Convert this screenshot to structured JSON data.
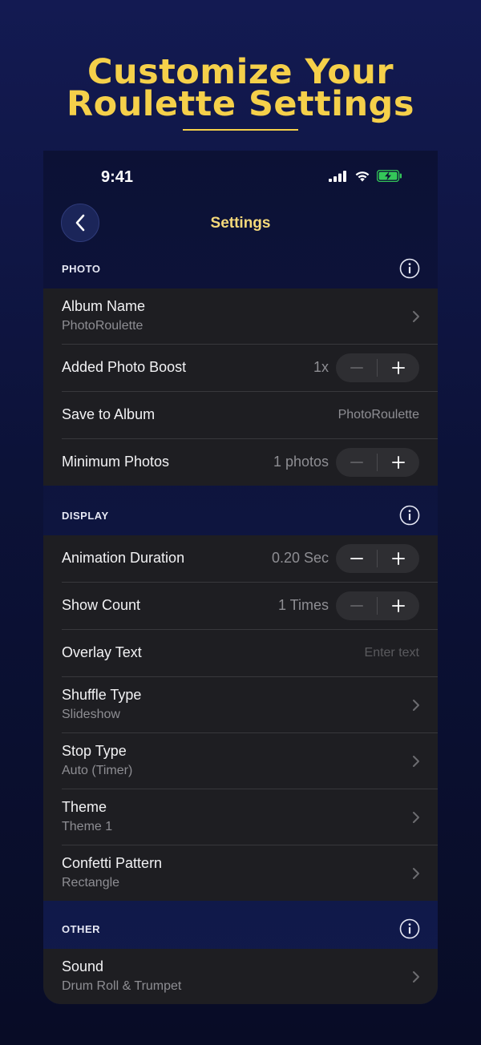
{
  "headline": {
    "line1": "Customize Your",
    "line2": "Roulette Settings"
  },
  "status_bar": {
    "time": "9:41"
  },
  "nav": {
    "title": "Settings"
  },
  "sections": {
    "photo": {
      "label": "PHOTO",
      "album_name": {
        "title": "Album Name",
        "subtitle": "PhotoRoulette"
      },
      "photo_boost": {
        "title": "Added Photo Boost",
        "value": "1x"
      },
      "save_to_album": {
        "title": "Save to Album",
        "value": "PhotoRoulette"
      },
      "minimum_photos": {
        "title": "Minimum Photos",
        "value": "1 photos"
      }
    },
    "display": {
      "label": "DISPLAY",
      "animation_duration": {
        "title": "Animation Duration",
        "value": "0.20 Sec"
      },
      "show_count": {
        "title": "Show Count",
        "value": "1 Times"
      },
      "overlay_text": {
        "title": "Overlay Text",
        "placeholder": "Enter text"
      },
      "shuffle_type": {
        "title": "Shuffle Type",
        "subtitle": "Slideshow"
      },
      "stop_type": {
        "title": "Stop Type",
        "subtitle": "Auto (Timer)"
      },
      "theme": {
        "title": "Theme",
        "subtitle": "Theme 1"
      },
      "confetti_pattern": {
        "title": "Confetti Pattern",
        "subtitle": "Rectangle"
      }
    },
    "other": {
      "label": "OTHER",
      "sound": {
        "title": "Sound",
        "subtitle": "Drum Roll & Trumpet"
      }
    }
  },
  "icons": {
    "back": "chevron-left-icon",
    "info": "info-icon",
    "chevron": "chevron-right-icon",
    "minus": "minus-icon",
    "plus": "plus-icon"
  },
  "colors": {
    "accent_gold": "#f5d04a",
    "background_navy": "#0c1238",
    "cell_background": "#1e1e22",
    "battery_green": "#34c759"
  }
}
